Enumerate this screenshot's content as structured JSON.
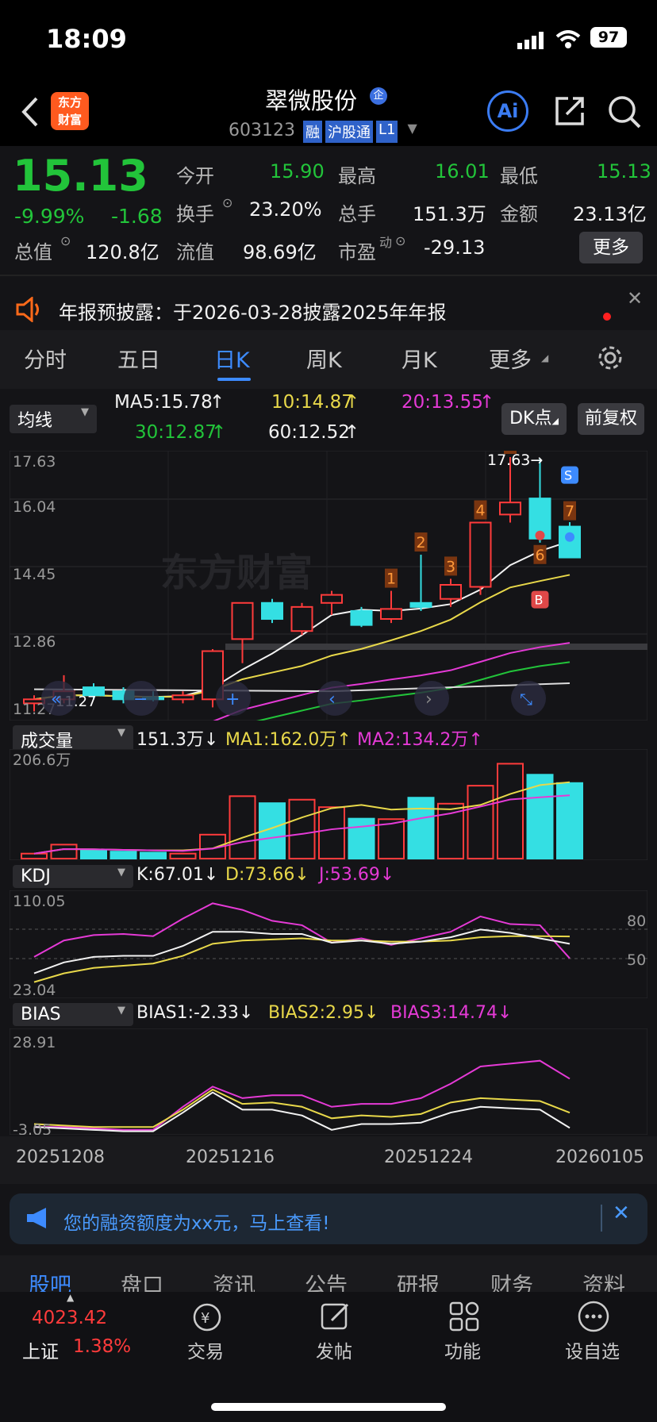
{
  "status": {
    "time": "18:09",
    "battery": "97"
  },
  "header": {
    "title": "翠微股份",
    "code": "603123",
    "badges": [
      "融",
      "沪股通",
      "L1"
    ],
    "logo": "东方财富"
  },
  "quote": {
    "price": "15.13",
    "change_pct": "-9.99%",
    "change": "-1.68",
    "open_label": "今开",
    "open": "15.90",
    "high_label": "最高",
    "high": "16.01",
    "low_label": "最低",
    "low": "15.13",
    "turnover_label": "换手",
    "turnover": "23.20%",
    "volume_label": "总手",
    "volume": "151.3万",
    "amount_label": "金额",
    "amount": "23.13亿",
    "mktcap_label": "总值",
    "mktcap": "120.8亿",
    "float_label": "流值",
    "float": "98.69亿",
    "pe_label": "市盈",
    "pe_sup": "动",
    "pe": "-29.13",
    "more": "更多"
  },
  "notice": {
    "text": "年报预披露：于2026-03-28披露2025年年报"
  },
  "tabs": [
    "分时",
    "五日",
    "日K",
    "周K",
    "月K",
    "更多"
  ],
  "active_tab": "日K",
  "ma": {
    "select": "均线",
    "ma5": "MA5:15.78",
    "ma10": "10:14.87",
    "ma20": "20:13.55",
    "ma30": "30:12.87",
    "ma60": "60:12.52",
    "dk": "DK点",
    "fq": "前复权"
  },
  "kchart": {
    "axis": [
      "17.63",
      "16.04",
      "14.45",
      "12.86",
      "11.27"
    ],
    "high_mark": "17.63→",
    "low_mark": "11.27",
    "watermark": "东方财富"
  },
  "vol": {
    "select": "成交量",
    "v": "151.3万",
    "ma1": "MA1:162.0万",
    "ma2": "MA2:134.2万",
    "axis_top": "206.6万"
  },
  "kdj": {
    "select": "KDJ",
    "k": "K:67.01",
    "d": "D:73.66",
    "j": "J:53.69",
    "axis_top": "110.05",
    "axis_bottom": "23.04",
    "lv80": "80",
    "lv50": "50"
  },
  "bias": {
    "select": "BIAS",
    "b1": "BIAS1:-2.33",
    "b2": "BIAS2:2.95",
    "b3": "BIAS3:14.74",
    "axis_top": "28.91",
    "axis_bottom": "-3.05"
  },
  "dates": [
    "20251208",
    "20251216",
    "20251224",
    "20260105"
  ],
  "banner": {
    "text": "您的融资额度为xx元，马上查看!"
  },
  "subtabs": [
    "股吧",
    "盘口",
    "资讯",
    "公告",
    "研报",
    "财务",
    "资料"
  ],
  "bottom": {
    "index_value": "4023.42",
    "index_name": "上证",
    "index_pct": "1.38%",
    "items": [
      "交易",
      "发帖",
      "功能",
      "设自选"
    ]
  },
  "chart_data": {
    "type": "candlestick",
    "candles": [
      {
        "o": 11.5,
        "h": 11.7,
        "l": 11.3,
        "c": 11.6
      },
      {
        "o": 11.6,
        "h": 12.2,
        "l": 11.5,
        "c": 11.8
      },
      {
        "o": 11.9,
        "h": 12.0,
        "l": 11.6,
        "c": 11.7
      },
      {
        "o": 11.8,
        "h": 11.9,
        "l": 11.5,
        "c": 11.6
      },
      {
        "o": 11.65,
        "h": 11.8,
        "l": 11.55,
        "c": 11.6
      },
      {
        "o": 11.6,
        "h": 11.8,
        "l": 11.5,
        "c": 11.7
      },
      {
        "o": 11.6,
        "h": 12.85,
        "l": 11.4,
        "c": 12.8
      },
      {
        "o": 13.1,
        "h": 13.2,
        "l": 12.5,
        "c": 14.0
      },
      {
        "o": 14.0,
        "h": 14.1,
        "l": 13.5,
        "c": 13.6
      },
      {
        "o": 13.3,
        "h": 14.0,
        "l": 13.2,
        "c": 13.9
      },
      {
        "o": 14.0,
        "h": 14.3,
        "l": 13.7,
        "c": 14.2
      },
      {
        "o": 13.8,
        "h": 13.9,
        "l": 13.4,
        "c": 13.45
      },
      {
        "o": 13.6,
        "h": 14.3,
        "l": 13.5,
        "c": 13.85
      },
      {
        "o": 14.0,
        "h": 15.2,
        "l": 13.8,
        "c": 13.9
      },
      {
        "o": 14.1,
        "h": 14.6,
        "l": 13.9,
        "c": 14.45
      },
      {
        "o": 14.4,
        "h": 16.0,
        "l": 14.2,
        "c": 16.0
      },
      {
        "o": 16.2,
        "h": 17.63,
        "l": 16.0,
        "c": 16.5
      },
      {
        "o": 16.6,
        "h": 17.6,
        "l": 15.5,
        "c": 15.6
      },
      {
        "o": 15.9,
        "h": 16.01,
        "l": 15.13,
        "c": 15.13
      }
    ],
    "volumes": [
      10,
      28,
      18,
      14,
      12,
      10,
      48,
      125,
      111,
      118,
      103,
      80,
      79,
      122,
      110,
      146,
      190,
      168,
      151.3
    ],
    "kdj_k": [
      40,
      50,
      55,
      56,
      56,
      65,
      78,
      78,
      76,
      76,
      68,
      70,
      67,
      69,
      73,
      80,
      77,
      72,
      67
    ],
    "kdj_d": [
      32,
      40,
      45,
      47,
      49,
      56,
      67,
      70,
      71,
      72,
      70,
      70,
      69,
      69,
      70,
      73,
      74,
      74,
      73.66
    ],
    "kdj_j": [
      55,
      70,
      75,
      76,
      74,
      90,
      104,
      98,
      88,
      84,
      68,
      72,
      66,
      72,
      78,
      92,
      85,
      84,
      53.69
    ],
    "bias1": [
      -2,
      -2.5,
      -3,
      -3.5,
      -3.5,
      3,
      10,
      4,
      4,
      2,
      -3,
      -1,
      -1,
      -0.5,
      3,
      5,
      4.5,
      4,
      -2.33
    ],
    "bias2": [
      -1,
      -1.5,
      -2,
      -2,
      -2,
      4,
      11,
      6,
      6.5,
      5,
      1,
      2,
      1.5,
      2.5,
      6.5,
      8,
      7.5,
      7,
      2.95
    ],
    "bias3": [
      -2,
      -2,
      -2.5,
      -3,
      -3,
      5,
      12,
      8,
      9,
      9,
      5,
      6,
      6,
      8,
      13,
      19,
      20,
      21,
      14.74
    ]
  }
}
